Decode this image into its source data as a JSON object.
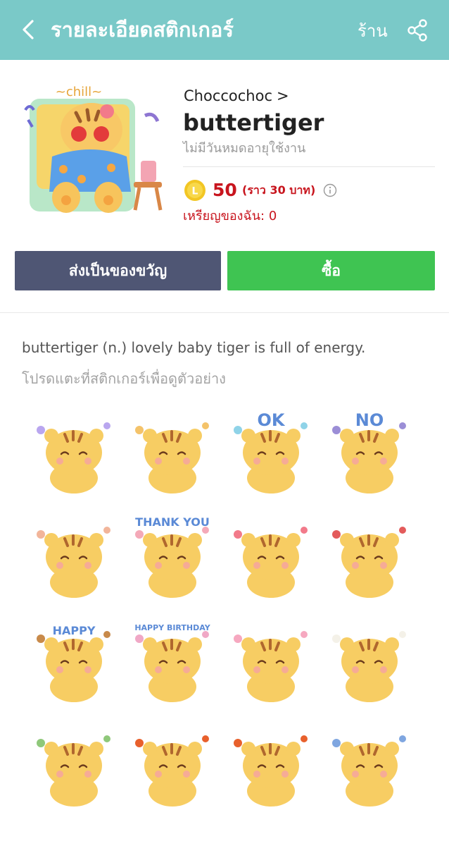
{
  "header": {
    "title": "รายละเอียดสติกเกอร์",
    "shop_label": "ร้าน",
    "background": "#7ac9c8"
  },
  "sticker_pack": {
    "creator": "Choccochoc",
    "creator_chevron": ">",
    "title": "buttertiger",
    "validity": "ไม่มีวันหมดอายุใช้งาน",
    "price_coin_letter": "L",
    "price": "50",
    "price_approx": "(ราว 30 บาท)",
    "coins_owned": "เหรียญของฉัน: 0",
    "main_sticker_text": "~chill~",
    "price_color": "#c8151e"
  },
  "buttons": {
    "gift_label": "ส่งเป็นของขวัญ",
    "buy_label": "ซื้อ",
    "gift_color": "#4f5674",
    "buy_color": "#3fc452"
  },
  "description": "buttertiger (n.) lovely baby tiger is full of energy.",
  "hint": "โปรดแตะที่สติกเกอร์เพื่อดูตัวอย่าง",
  "stickers": [
    {
      "name": "sticker-waving",
      "text": ""
    },
    {
      "name": "sticker-sparkle",
      "text": ""
    },
    {
      "name": "sticker-ok",
      "text": "OK"
    },
    {
      "name": "sticker-no",
      "text": "NO"
    },
    {
      "name": "sticker-peekaboo",
      "text": ""
    },
    {
      "name": "sticker-thank-you",
      "text": "THANK YOU"
    },
    {
      "name": "sticker-hearts",
      "text": ""
    },
    {
      "name": "sticker-watermelon",
      "text": ""
    },
    {
      "name": "sticker-happy",
      "text": "HAPPY"
    },
    {
      "name": "sticker-birthday-cake",
      "text": "HAPPY BIRTHDAY"
    },
    {
      "name": "sticker-pink-hood",
      "text": ""
    },
    {
      "name": "sticker-bear-friend",
      "text": ""
    },
    {
      "name": "sticker-frog-hat",
      "text": ""
    },
    {
      "name": "sticker-angry-mark",
      "text": ""
    },
    {
      "name": "sticker-pouting",
      "text": ""
    },
    {
      "name": "sticker-shocked",
      "text": ""
    }
  ]
}
